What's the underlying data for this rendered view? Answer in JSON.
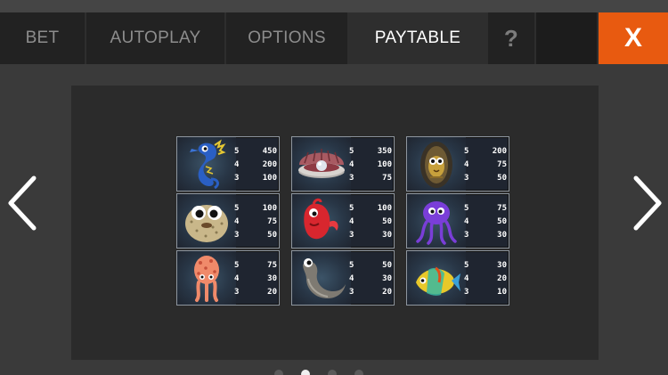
{
  "tabs": [
    {
      "label": "BET"
    },
    {
      "label": "AUTOPLAY"
    },
    {
      "label": "OPTIONS"
    },
    {
      "label": "PAYTABLE"
    }
  ],
  "help_label": "?",
  "close_label": "X",
  "colors": {
    "accent": "#e85a10",
    "active_tab_text": "#ffffff",
    "inactive_tab_text": "#8d8d8d"
  },
  "paytable": [
    {
      "symbol": "seahorse",
      "pays": [
        {
          "count": "5",
          "amount": "450"
        },
        {
          "count": "4",
          "amount": "200"
        },
        {
          "count": "3",
          "amount": "100"
        }
      ]
    },
    {
      "symbol": "pearl-clam",
      "pays": [
        {
          "count": "5",
          "amount": "350"
        },
        {
          "count": "4",
          "amount": "100"
        },
        {
          "count": "3",
          "amount": "75"
        }
      ]
    },
    {
      "symbol": "fish-in-shell",
      "pays": [
        {
          "count": "5",
          "amount": "200"
        },
        {
          "count": "4",
          "amount": "75"
        },
        {
          "count": "3",
          "amount": "50"
        }
      ]
    },
    {
      "symbol": "pufferfish",
      "pays": [
        {
          "count": "5",
          "amount": "100"
        },
        {
          "count": "4",
          "amount": "75"
        },
        {
          "count": "3",
          "amount": "50"
        }
      ]
    },
    {
      "symbol": "red-fish",
      "pays": [
        {
          "count": "5",
          "amount": "100"
        },
        {
          "count": "4",
          "amount": "50"
        },
        {
          "count": "3",
          "amount": "30"
        }
      ]
    },
    {
      "symbol": "purple-octopus",
      "pays": [
        {
          "count": "5",
          "amount": "75"
        },
        {
          "count": "4",
          "amount": "50"
        },
        {
          "count": "3",
          "amount": "30"
        }
      ]
    },
    {
      "symbol": "spotted-squid",
      "pays": [
        {
          "count": "5",
          "amount": "75"
        },
        {
          "count": "4",
          "amount": "30"
        },
        {
          "count": "3",
          "amount": "20"
        }
      ]
    },
    {
      "symbol": "grey-eel",
      "pays": [
        {
          "count": "5",
          "amount": "50"
        },
        {
          "count": "4",
          "amount": "30"
        },
        {
          "count": "3",
          "amount": "20"
        }
      ]
    },
    {
      "symbol": "tropical-fish",
      "pays": [
        {
          "count": "5",
          "amount": "30"
        },
        {
          "count": "4",
          "amount": "20"
        },
        {
          "count": "3",
          "amount": "10"
        }
      ]
    }
  ],
  "pagination": {
    "pages": 4,
    "current": 2
  }
}
